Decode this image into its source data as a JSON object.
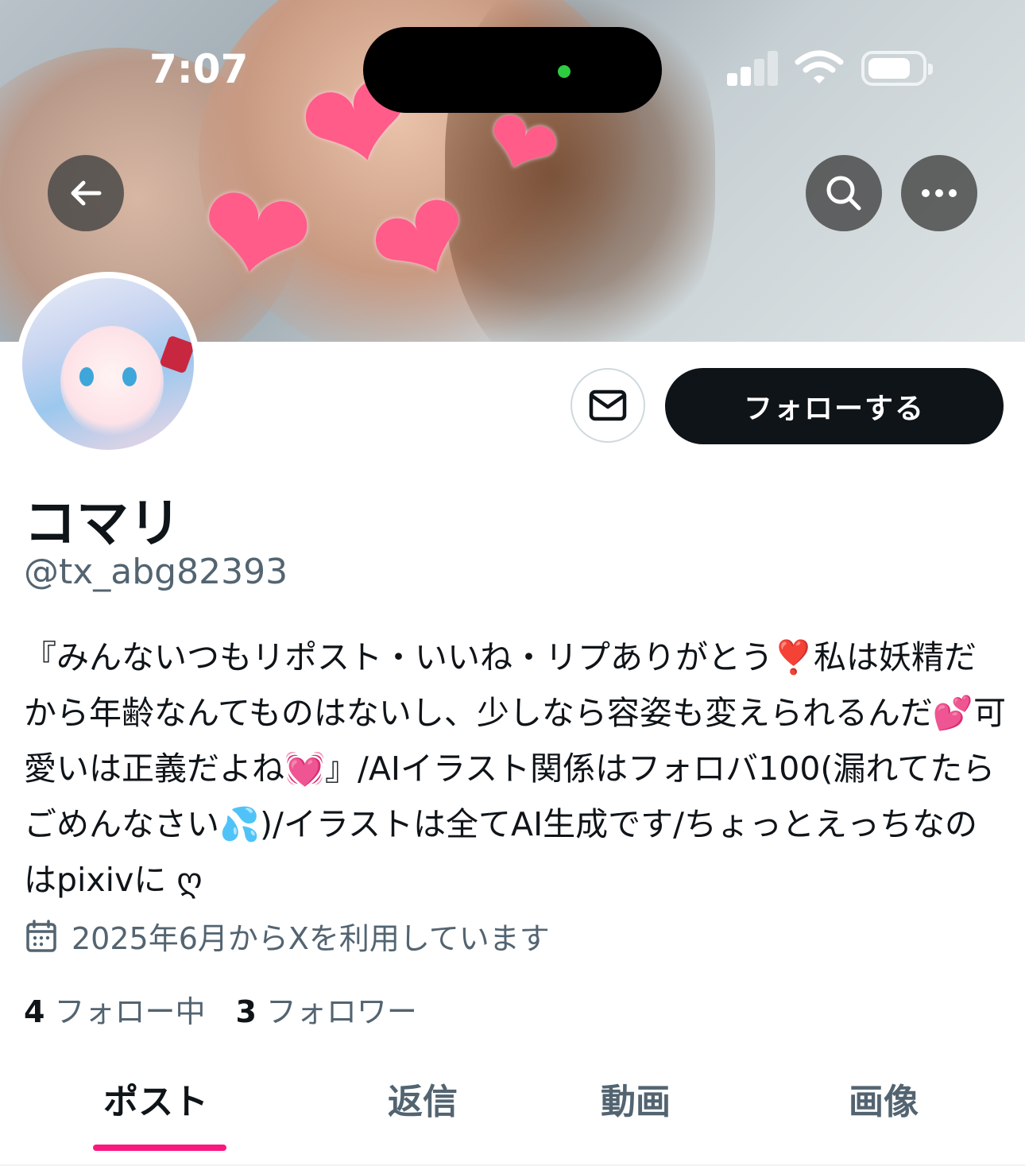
{
  "status_bar": {
    "time": "7:07"
  },
  "header": {
    "back_label": "戻る",
    "search_label": "検索",
    "more_label": "その他"
  },
  "profile": {
    "display_name": "コマリ",
    "handle": "@tx_abg82393",
    "follow_label": "フォローする",
    "bio": "『みんないつもリポスト・いいね・リプありがとう❣️私は妖精だから年齢なんてものはないし、少しなら容姿も変えられるんだ💕可愛いは正義だよね💓』/AIイラスト関係はフォロバ100(漏れてたらごめんなさい💦)/イラストは全てAI生成です/ちょっとえっちなのはpixivに ღ",
    "joined": "2025年6月からXを利用しています",
    "following_count": "4",
    "following_label": "フォロー中",
    "followers_count": "3",
    "followers_label": "フォロワー"
  },
  "tabs": [
    {
      "label": "ポスト",
      "active": true
    },
    {
      "label": "返信",
      "active": false
    },
    {
      "label": "動画",
      "active": false
    },
    {
      "label": "画像",
      "active": false
    }
  ],
  "colors": {
    "accent": "#f91880",
    "text": "#0f1419",
    "secondary": "#536471"
  }
}
